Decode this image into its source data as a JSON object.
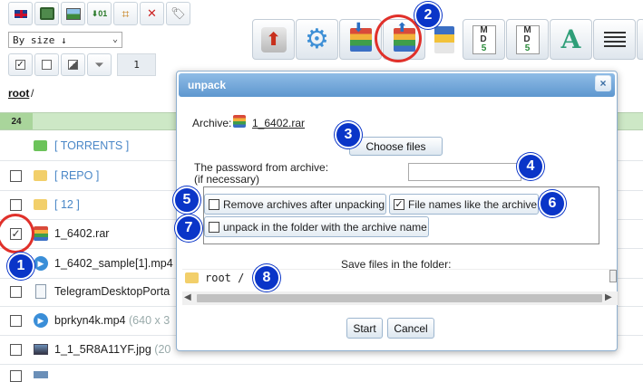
{
  "toolbar_small": {
    "icons": [
      "flag-uk-icon",
      "refresh-image-icon",
      "picture-icon",
      "binary-download-icon",
      "crop-icon",
      "delete-image-icon",
      "tag-icon"
    ]
  },
  "sort": {
    "value": "By size ↓",
    "chevron": "⌄"
  },
  "selection": {
    "page_value": "1"
  },
  "toolbar_big": {
    "icons": [
      "archive-upload-icon",
      "settings-gear-icon",
      "pack-icon",
      "unpack-icon",
      "extract-icon",
      "md5-icon",
      "md5-folder-icon",
      "font-icon",
      "list-view-icon"
    ]
  },
  "breadcrumb": {
    "root": "root",
    "sep": "/"
  },
  "list": {
    "count": "24",
    "rows": [
      {
        "name": "[ TORRENTS ]",
        "type": "folder-green",
        "checked": false,
        "meta": ""
      },
      {
        "name": "[ REPO ]",
        "type": "folder",
        "checked": false,
        "meta": ""
      },
      {
        "name": "[ 12 ]",
        "type": "folder",
        "checked": false,
        "meta": ""
      },
      {
        "name": "1_6402.rar",
        "type": "rar",
        "checked": true,
        "meta": ""
      },
      {
        "name": "1_6402_sample[1].mp4",
        "type": "video",
        "checked": false,
        "meta": ""
      },
      {
        "name": "TelegramDesktopPorta",
        "type": "file",
        "checked": false,
        "meta": ""
      },
      {
        "name": "bprkyn4k.mp4",
        "type": "video",
        "checked": false,
        "meta": "(640 x 3"
      },
      {
        "name": "1_1_5R8A11YF.jpg",
        "type": "image",
        "checked": false,
        "meta": "(20"
      },
      {
        "name": "",
        "type": "image",
        "checked": false,
        "meta": ""
      }
    ]
  },
  "dialog": {
    "title": "unpack",
    "close": "×",
    "archive_label": "Archive:",
    "archive_name": "1_6402.rar",
    "choose_files": "Choose files",
    "password_label_1": "The password from archive:",
    "password_label_2": "(if necessary)",
    "password_value": "",
    "options": {
      "remove_after": {
        "label": "Remove archives after unpacking",
        "checked": false
      },
      "names_like_archive": {
        "label": "File names like the archive",
        "checked": true
      },
      "unpack_in_folder": {
        "label": "unpack in the folder with the archive name",
        "checked": false
      }
    },
    "save_label": "Save files in the folder:",
    "folder_path": "root /",
    "start": "Start",
    "cancel": "Cancel"
  },
  "markers": [
    "1",
    "2",
    "3",
    "4",
    "5",
    "6",
    "7",
    "8"
  ],
  "colors": {
    "dialog_title": "#6ba3d8",
    "list_header": "#cde8c6",
    "marker": "#0a35c8",
    "highlight_ring": "#e0302a",
    "folder_link": "#4a87c7"
  }
}
